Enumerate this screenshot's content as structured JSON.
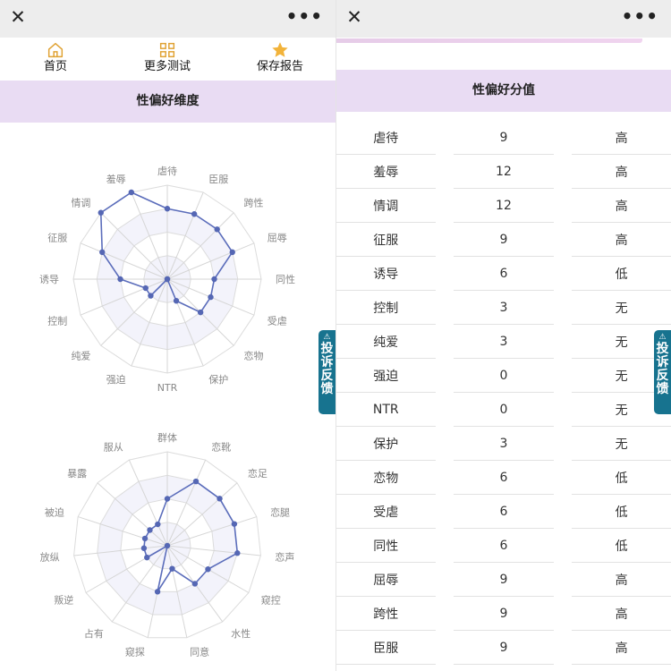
{
  "left": {
    "titlebar": {
      "close": "✕",
      "more": "•••"
    },
    "nav": [
      {
        "label": "首页",
        "icon": "home-icon"
      },
      {
        "label": "更多测试",
        "icon": "grid-icon"
      },
      {
        "label": "保存报告",
        "icon": "star-icon"
      }
    ],
    "section_title": "性偏好维度",
    "feedback": {
      "icon": "⚠",
      "label": "投诉反馈"
    }
  },
  "right": {
    "titlebar": {
      "close": "✕",
      "more": "•••"
    },
    "section_title": "性偏好分值",
    "feedback": {
      "icon": "⚠",
      "label": "投诉反馈"
    },
    "rows": [
      {
        "name": "虐待",
        "score": "9",
        "level": "高"
      },
      {
        "name": "羞辱",
        "score": "12",
        "level": "高"
      },
      {
        "name": "情调",
        "score": "12",
        "level": "高"
      },
      {
        "name": "征服",
        "score": "9",
        "level": "高"
      },
      {
        "name": "诱导",
        "score": "6",
        "level": "低"
      },
      {
        "name": "控制",
        "score": "3",
        "level": "无"
      },
      {
        "name": "纯爱",
        "score": "3",
        "level": "无"
      },
      {
        "name": "强迫",
        "score": "0",
        "level": "无"
      },
      {
        "name": "NTR",
        "score": "0",
        "level": "无"
      },
      {
        "name": "保护",
        "score": "3",
        "level": "无"
      },
      {
        "name": "恋物",
        "score": "6",
        "level": "低"
      },
      {
        "name": "受虐",
        "score": "6",
        "level": "低"
      },
      {
        "name": "同性",
        "score": "6",
        "level": "低"
      },
      {
        "name": "屈辱",
        "score": "9",
        "level": "高"
      },
      {
        "name": "跨性",
        "score": "9",
        "level": "高"
      },
      {
        "name": "臣服",
        "score": "9",
        "level": "高"
      }
    ]
  },
  "chart_data": [
    {
      "type": "radar",
      "categories": [
        "虐待",
        "臣服",
        "跨性",
        "屈辱",
        "同性",
        "受虐",
        "恋物",
        "保护",
        "NTR",
        "强迫",
        "纯爱",
        "控制",
        "诱导",
        "征服",
        "情调",
        "羞辱"
      ],
      "values": [
        9,
        9,
        9,
        9,
        6,
        6,
        6,
        3,
        0,
        0,
        3,
        3,
        6,
        9,
        12,
        12
      ],
      "max": 12,
      "rings": 4,
      "line_color": "#5b6dbb",
      "point_color": "#5567b4",
      "band_colors": [
        "#ffffff",
        "#f3f3fb"
      ]
    },
    {
      "type": "radar",
      "categories": [
        "群体",
        "恋靴",
        "恋足",
        "恋腿",
        "恋声",
        "窥控",
        "水性",
        "同意",
        "窥探",
        "占有",
        "叛逆",
        "放纵",
        "被迫",
        "暴露",
        "服从"
      ],
      "values": [
        6,
        9,
        9,
        9,
        9,
        6,
        6,
        3,
        6,
        0,
        3,
        3,
        3,
        3,
        3
      ],
      "max": 12,
      "rings": 4,
      "line_color": "#5b6dbb",
      "point_color": "#5567b4",
      "band_colors": [
        "#ffffff",
        "#f3f3fb"
      ]
    }
  ]
}
